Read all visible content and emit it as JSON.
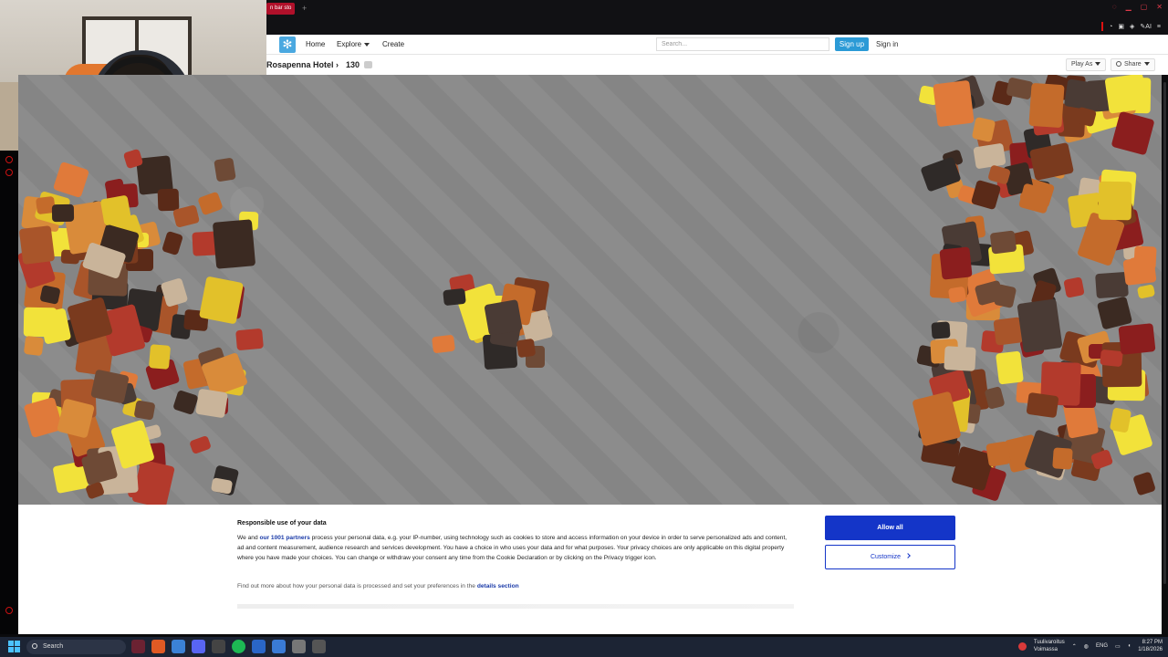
{
  "browser": {
    "tab_title": "n bar sto",
    "new_tab": "+",
    "toolbar_ai": "AI"
  },
  "site": {
    "nav": {
      "home": "Home",
      "explore": "Explore",
      "create": "Create"
    },
    "search_placeholder": "Search...",
    "signup": "Sign up",
    "signin": "Sign in"
  },
  "puzzle": {
    "title": "Rosapenna Hotel",
    "separator": "›",
    "piece_count": "130",
    "play_as": "Play As",
    "share": "Share"
  },
  "cookie": {
    "title": "Responsible use of your data",
    "text_prefix": "We and",
    "partners_link": "our 1001 partners",
    "text_body": "process your personal data, e.g. your IP-number, using technology such as cookies to store and access information on your device in order to serve personalized ads and content, ad and content measurement, audience research and services development. You have a choice in who uses your data and for what purposes. Your privacy choices are only applicable on this digital property where you have made your choices. You can change or withdraw your consent any time from the Cookie Declaration or by clicking on the Privacy trigger icon.",
    "find_more": "Find out more about how your personal data is processed and set your preferences in the",
    "details_link": "details section",
    "allow_all": "Allow all",
    "customize": "Customize"
  },
  "taskbar": {
    "search": "Search",
    "notice_title": "Tuulivaroitus",
    "notice_sub": "Voimassa",
    "lang": "ENG",
    "time": "8:27 PM",
    "date": "1/18/2026"
  },
  "colors": {
    "accent_blue": "#2b9ad6",
    "consent_blue": "#1435c8",
    "board_gray": "#878787",
    "taskbar": "#1c2434"
  }
}
